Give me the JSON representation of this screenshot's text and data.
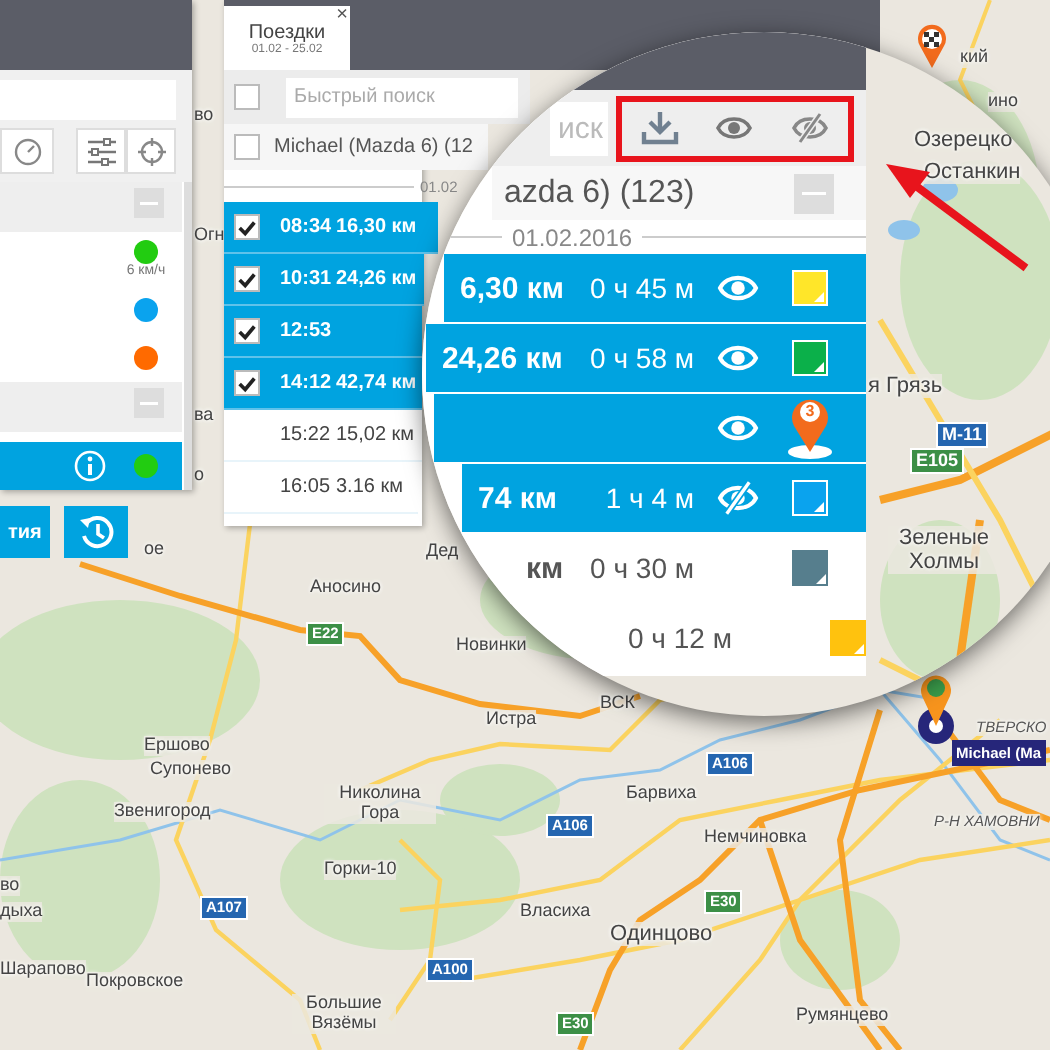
{
  "left_panel": {
    "groups": [
      {
        "expanded": true,
        "objects": [
          {
            "color": "#22cc11",
            "speed": "6 км/ч",
            "selected": false
          },
          {
            "color": "#0aa3ee",
            "selected": false
          },
          {
            "color": "#ff6a00",
            "selected": false
          }
        ]
      },
      {
        "expanded": true,
        "objects": [
          {
            "color": "#22cc11",
            "selected": true
          }
        ]
      }
    ],
    "buttons": [
      {
        "kind": "text",
        "label": "тия"
      },
      {
        "kind": "history"
      }
    ]
  },
  "trips_panel": {
    "tab": {
      "title": "Поездки",
      "subtitle": "01.02 - 25.02",
      "close": "×",
      "selected": true
    },
    "search": {
      "placeholder": "Быстрый поиск"
    },
    "select_all": {
      "checked": false
    },
    "group": {
      "label": "Michael (Mazda 6) (12",
      "checked": false
    },
    "date": "01.02",
    "rows": [
      {
        "time": "08:34",
        "distance": "16,30 км",
        "selected": true
      },
      {
        "time": "10:31",
        "distance": "24,26 км",
        "selected": true
      },
      {
        "time": "12:53",
        "selected": true
      },
      {
        "time": "14:12",
        "distance": "42,74 км",
        "selected": true
      },
      {
        "time": "15:22",
        "distance": "15,02 км",
        "selected": false
      },
      {
        "time": "16:05",
        "distance": "3.16 км",
        "selected": false
      }
    ]
  },
  "magnifier": {
    "search": {
      "placeholder": "иск"
    },
    "toolbar_highlighted": true,
    "group": {
      "label": "azda 6) (123)",
      "expanded": true
    },
    "date": "01.02.2016",
    "rows": [
      {
        "kind": "track",
        "distance": "6,30 км",
        "duration": "0 ч 45 м",
        "selected": true,
        "visible": true,
        "color": "#ffe629"
      },
      {
        "kind": "track",
        "distance": "24,26 км",
        "duration": "0 ч 58 м",
        "selected": true,
        "visible": true,
        "color": "#0bb04a"
      },
      {
        "kind": "stop",
        "badge": "3",
        "selected": true,
        "visible": true
      },
      {
        "kind": "track",
        "distance": "74 км",
        "duration": "1 ч 4 м",
        "selected": true,
        "visible": false,
        "color": "#0aa3ee"
      },
      {
        "kind": "track",
        "distance": "км",
        "duration": "0 ч 30 м",
        "selected": false,
        "color": "#567e8d"
      },
      {
        "kind": "track",
        "duration": "0 ч 12 м",
        "selected": false,
        "color": "#ffc20e"
      }
    ],
    "map_labels": [
      {
        "text": "Озерецко"
      },
      {
        "text": "Останкин"
      },
      {
        "text": "я Грязь"
      },
      {
        "text": "Зеленые Холмы"
      }
    ],
    "shields": [
      {
        "text": "M-11",
        "color": "#2566b0"
      },
      {
        "text": "E105",
        "color": "#3c8f46"
      }
    ]
  },
  "map": {
    "labels": [
      {
        "text": "Аносино",
        "kind": "town"
      },
      {
        "text": "Новинки",
        "kind": "town"
      },
      {
        "text": "ВСК",
        "kind": "town"
      },
      {
        "text": "Истра",
        "kind": "town"
      },
      {
        "text": "Ершово",
        "kind": "town"
      },
      {
        "text": "Супонево",
        "kind": "town"
      },
      {
        "text": "Звенигород",
        "kind": "town"
      },
      {
        "text": "Николина Гора",
        "kind": "town"
      },
      {
        "text": "Барвиха",
        "kind": "town"
      },
      {
        "text": "Немчиновка",
        "kind": "town"
      },
      {
        "text": "Горки-10",
        "kind": "town"
      },
      {
        "text": "Власиха",
        "kind": "town"
      },
      {
        "text": "Одинцово",
        "kind": "town"
      },
      {
        "text": "Шарапово",
        "kind": "town"
      },
      {
        "text": "Покровское",
        "kind": "town"
      },
      {
        "text": "Большие Вязёмы",
        "kind": "town"
      },
      {
        "text": "Румянцево",
        "kind": "town"
      },
      {
        "text": "во",
        "kind": "town"
      },
      {
        "text": "дыха",
        "kind": "town"
      },
      {
        "text": "ое",
        "kind": "town"
      },
      {
        "text": "Дед",
        "kind": "town"
      },
      {
        "text": "во",
        "kind": "town"
      },
      {
        "text": "Огн",
        "kind": "town"
      },
      {
        "text": "ва",
        "kind": "town"
      },
      {
        "text": "о",
        "kind": "town"
      },
      {
        "text": "кий",
        "kind": "town"
      },
      {
        "text": "ино",
        "kind": "town"
      },
      {
        "text": "ТВЕРСКО",
        "kind": "district"
      },
      {
        "text": "Р-Н ХАМОВНИ",
        "kind": "district"
      }
    ],
    "shields": [
      {
        "text": "E22",
        "color": "#3c8f46"
      },
      {
        "text": "A106",
        "color": "#2566b0"
      },
      {
        "text": "A106",
        "color": "#2566b0"
      },
      {
        "text": "A107",
        "color": "#2566b0"
      },
      {
        "text": "E30",
        "color": "#3c8f46"
      },
      {
        "text": "E30",
        "color": "#3c8f46"
      },
      {
        "text": "A100",
        "color": "#2566b0"
      }
    ],
    "vehicle_label": "Michael (Ma"
  }
}
